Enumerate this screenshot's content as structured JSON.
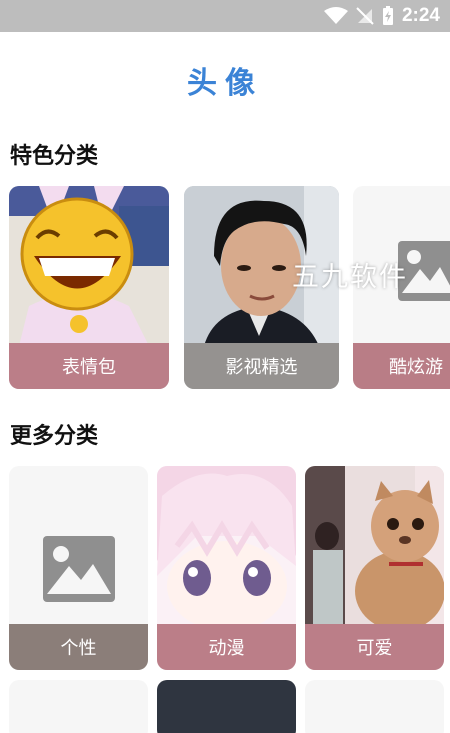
{
  "status_bar": {
    "time": "2:24",
    "icons": [
      "wifi-icon",
      "signal-off-icon",
      "battery-charging-icon"
    ]
  },
  "page": {
    "title": "头像"
  },
  "featured": {
    "heading": "特色分类",
    "cards": [
      {
        "label": "表情包",
        "image": "emoji-laughing-face"
      },
      {
        "label": "影视精选",
        "image": "actor-portrait"
      },
      {
        "label": "酷炫游",
        "image": "placeholder-image-icon"
      }
    ]
  },
  "more": {
    "heading": "更多分类",
    "cards": [
      {
        "label": "个性",
        "image": "placeholder-image-icon"
      },
      {
        "label": "动漫",
        "image": "anime-girl"
      },
      {
        "label": "可爱",
        "image": "cat-costume-photo"
      }
    ]
  },
  "watermark": "五九软件",
  "colors": {
    "title": "#3b83d6",
    "label_pink": "#b97d86",
    "label_gray": "#8e8580",
    "label_dark": "#8b7d7a",
    "status_bar": "#bdbdbd"
  }
}
